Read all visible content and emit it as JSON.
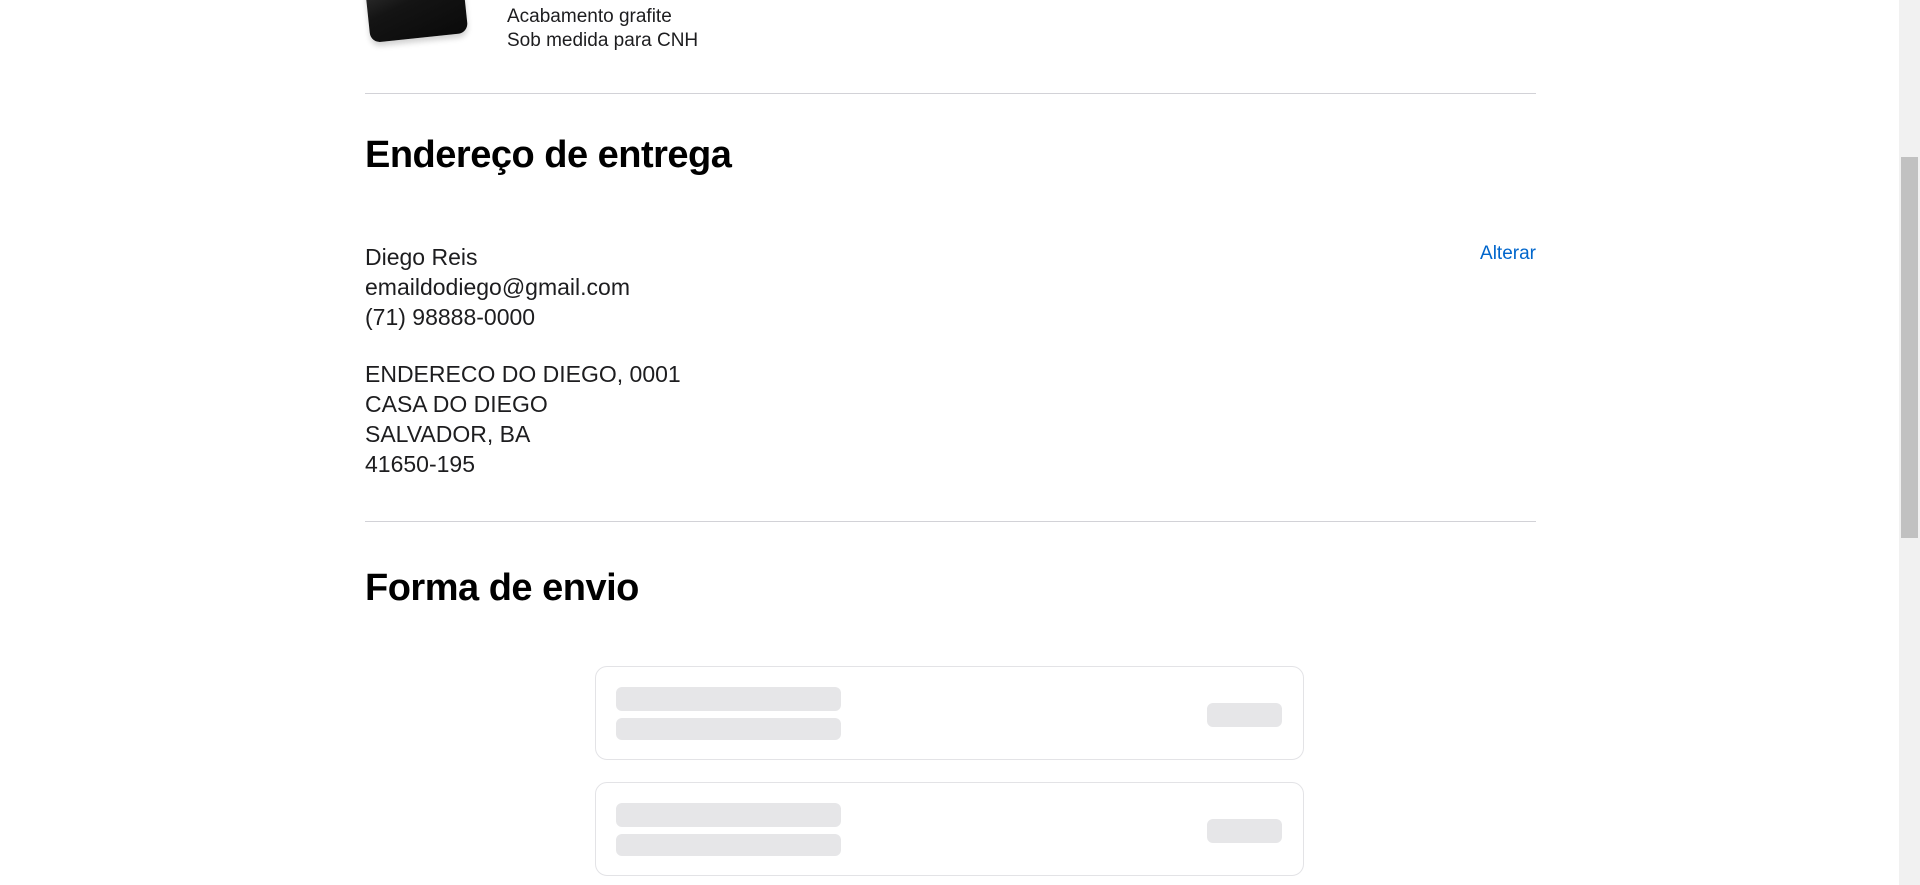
{
  "product": {
    "details": [
      "Acabamento grafite",
      "Sob medida para CNH"
    ]
  },
  "delivery_address": {
    "title": "Endereço de entrega",
    "change_label": "Alterar",
    "contact": {
      "name": "Diego Reis",
      "email": "emaildodiego@gmail.com",
      "phone": "(71) 98888-0000"
    },
    "address": {
      "street": "ENDERECO DO DIEGO, 0001",
      "complement": "CASA DO DIEGO",
      "city_state": "SALVADOR, BA",
      "postal_code": "41650-195"
    }
  },
  "shipping": {
    "title": "Forma de envio",
    "options_loading": true
  }
}
